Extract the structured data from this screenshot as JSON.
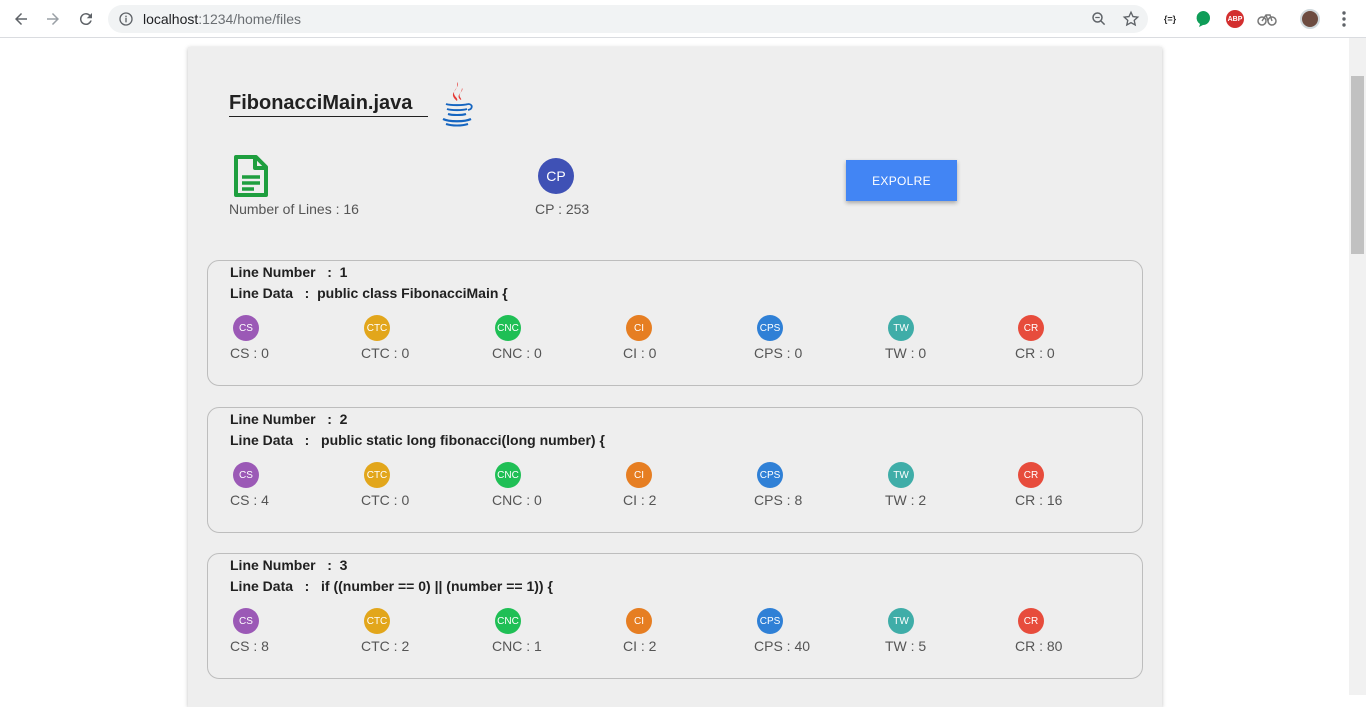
{
  "browser": {
    "url_host": "localhost",
    "url_path": ":1234/home/files",
    "ext_json_label": "{=}",
    "ext_abp_label": "ABP"
  },
  "file": {
    "title": "FibonacciMain.java",
    "lines_label": "Number of Lines : 16",
    "cp_badge": "CP",
    "cp_label": "CP : 253",
    "explore_label": "EXPOLRE"
  },
  "colors": {
    "CS": "#9b59b6",
    "CTC": "#e2a61b",
    "CNC": "#1fbf55",
    "CI": "#e67e22",
    "CPS": "#2f80d6",
    "TW": "#3fada8",
    "CR": "#e74c3c",
    "button": "#4285f4",
    "cp": "#3f51b5"
  },
  "lines": [
    {
      "line_number": "Line Number   :  1",
      "line_data": "Line Data   :  public class FibonacciMain {",
      "metrics": [
        {
          "code": "CS",
          "value": "CS : 0"
        },
        {
          "code": "CTC",
          "value": "CTC : 0"
        },
        {
          "code": "CNC",
          "value": "CNC : 0"
        },
        {
          "code": "CI",
          "value": "CI : 0"
        },
        {
          "code": "CPS",
          "value": "CPS : 0"
        },
        {
          "code": "TW",
          "value": "TW : 0"
        },
        {
          "code": "CR",
          "value": "CR : 0"
        }
      ]
    },
    {
      "line_number": "Line Number   :  2",
      "line_data": "Line Data   :   public static long fibonacci(long number) {",
      "metrics": [
        {
          "code": "CS",
          "value": "CS : 4"
        },
        {
          "code": "CTC",
          "value": "CTC : 0"
        },
        {
          "code": "CNC",
          "value": "CNC : 0"
        },
        {
          "code": "CI",
          "value": "CI : 2"
        },
        {
          "code": "CPS",
          "value": "CPS : 8"
        },
        {
          "code": "TW",
          "value": "TW : 2"
        },
        {
          "code": "CR",
          "value": "CR : 16"
        }
      ]
    },
    {
      "line_number": "Line Number   :  3",
      "line_data": "Line Data   :   if ((number == 0) || (number == 1)) {",
      "metrics": [
        {
          "code": "CS",
          "value": "CS : 8"
        },
        {
          "code": "CTC",
          "value": "CTC : 2"
        },
        {
          "code": "CNC",
          "value": "CNC : 1"
        },
        {
          "code": "CI",
          "value": "CI : 2"
        },
        {
          "code": "CPS",
          "value": "CPS : 40"
        },
        {
          "code": "TW",
          "value": "TW : 5"
        },
        {
          "code": "CR",
          "value": "CR : 80"
        }
      ]
    }
  ]
}
